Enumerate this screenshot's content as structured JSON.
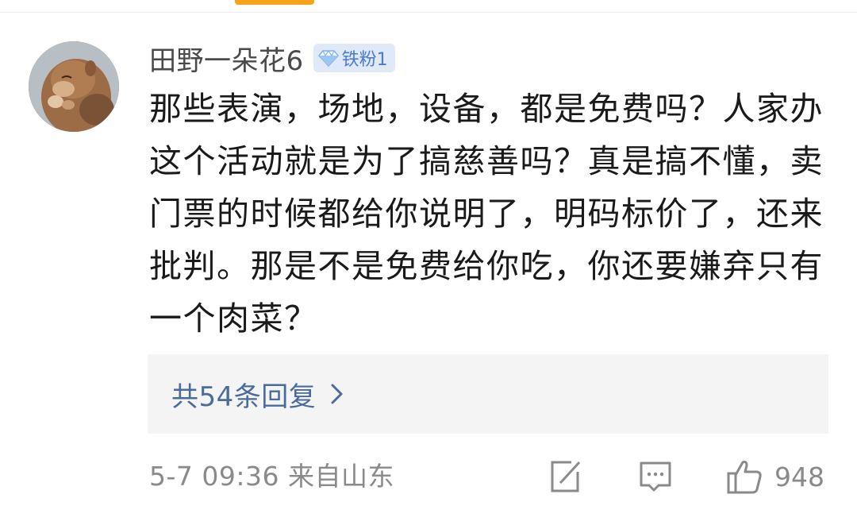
{
  "comment": {
    "username": "田野一朵花6",
    "badge": {
      "icon": "diamond-icon",
      "label": "铁粉1",
      "color": "#4a7bd0",
      "background": "#dfe9f8"
    },
    "text": "那些表演，场地，设备，都是免费吗？人家办这个活动就是为了搞慈善吗？真是搞不懂，卖门票的时候都给你说明了，明码标价了，还来批判。那是不是免费给你吃，你还要嫌弃只有一个肉菜？",
    "replies_label": "共54条回复",
    "timestamp": "5-7 09:36",
    "location": "来自山东",
    "actions": {
      "share_icon": "edit-share-icon",
      "comment_icon": "comment-bubble-icon",
      "like_icon": "thumbs-up-icon",
      "like_count": "948"
    }
  },
  "colors": {
    "accent_tab": "#f7a21b",
    "link": "#4b6b9c",
    "meta_text": "#8a8a8a"
  }
}
